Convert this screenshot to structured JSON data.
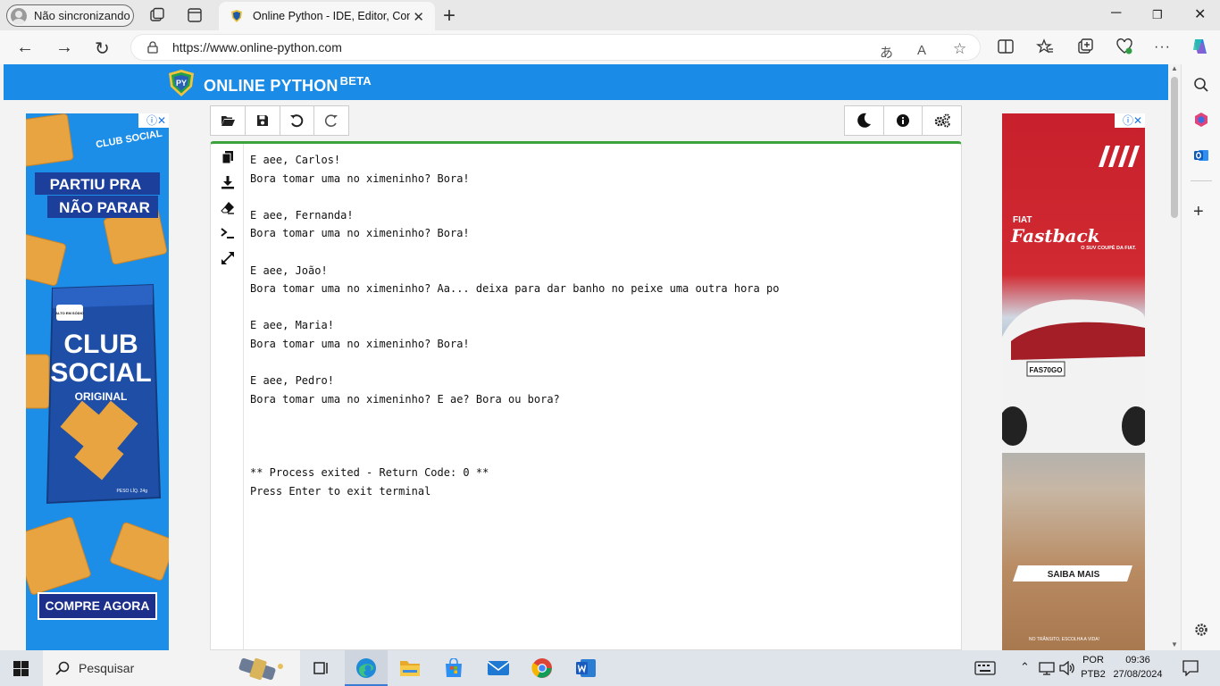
{
  "browser": {
    "profile_label": "Não sincronizando",
    "tab_title": "Online Python - IDE, Editor, Compiler",
    "url": "https://www.online-python.com"
  },
  "site": {
    "brand": "ONLINE PYTHON",
    "brand_badge": "BETA",
    "logo_text": "PY"
  },
  "ads": {
    "left": {
      "brand": "CLUB SOCIAL",
      "headline_1": "PARTIU PRA",
      "headline_2": "NÃO PARAR",
      "pack_badge": "ALTO EM SÓDIO",
      "pack_brand_1": "CLUB",
      "pack_brand_2": "SOCIAL",
      "pack_variant": "ORIGINAL",
      "pack_weight": "PESO LÍQ. 24g",
      "cta": "COMPRE AGORA"
    },
    "right": {
      "maker": "FIAT",
      "model": "Fastback",
      "tagline": "O SUV COUPÉ DA FIAT.",
      "plate": "FAS70GO",
      "cta": "SAIBA MAIS",
      "footer": "NO TRÂNSITO, ESCOLHA A VIDA!"
    },
    "marker": "ⓘ✕"
  },
  "terminal": {
    "lines": [
      "E aee, Carlos!",
      "Bora tomar uma no ximeninho? Bora!",
      "",
      "E aee, Fernanda!",
      "Bora tomar uma no ximeninho? Bora!",
      "",
      "E aee, João!",
      "Bora tomar uma no ximeninho? Aa... deixa para dar banho no peixe uma outra hora po",
      "",
      "E aee, Maria!",
      "Bora tomar uma no ximeninho? Bora!",
      "",
      "E aee, Pedro!",
      "Bora tomar uma no ximeninho? E ae? Bora ou bora?",
      "",
      "",
      "",
      "** Process exited - Return Code: 0 **",
      "Press Enter to exit terminal"
    ]
  },
  "taskbar": {
    "search_placeholder": "Pesquisar",
    "language": "POR",
    "layout": "PTB2",
    "time": "09:36",
    "date": "27/08/2024"
  },
  "colors": {
    "header_blue": "#1a8be6",
    "editor_accent": "#3ca33c",
    "ad_left_bg": "#1d8ee8",
    "ad_left_cta": "#1c2f8a"
  }
}
